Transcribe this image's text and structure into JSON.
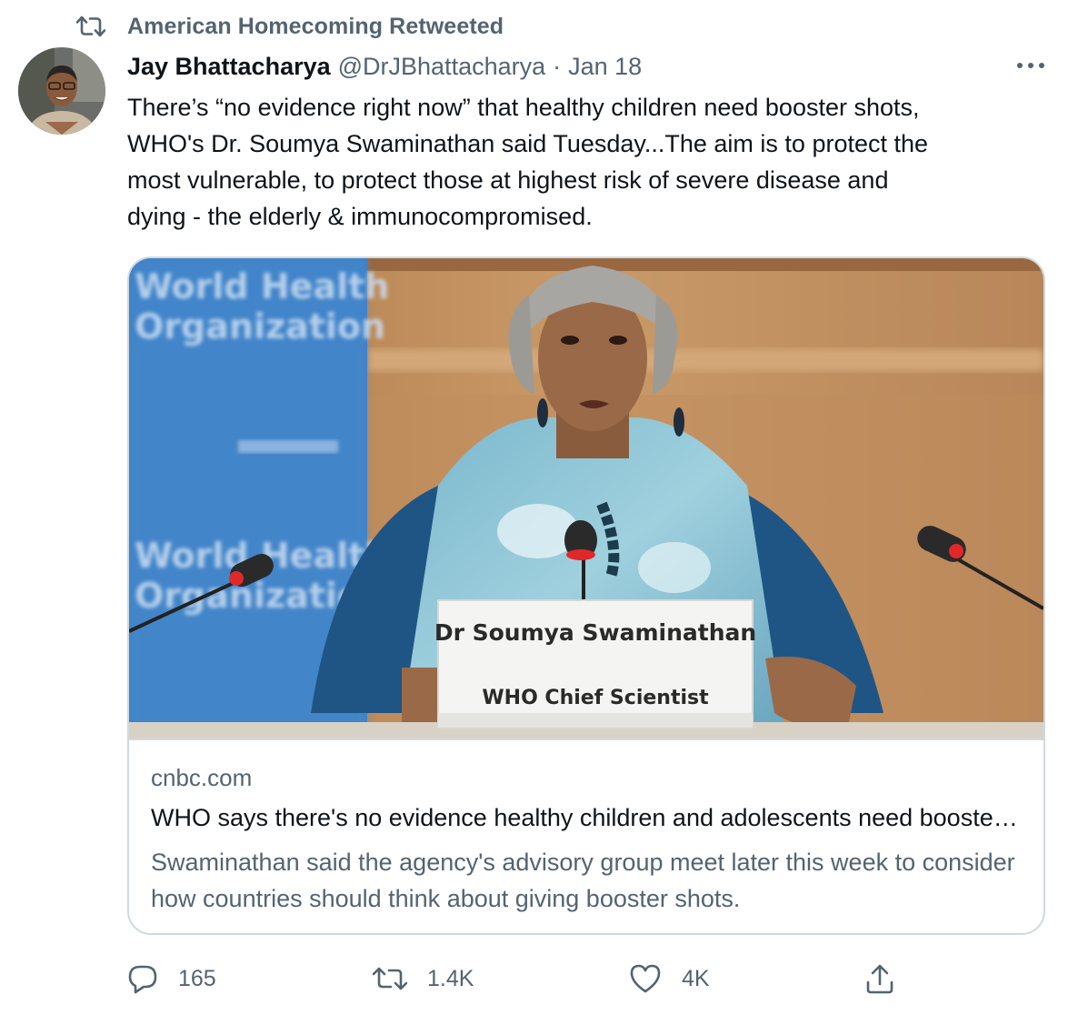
{
  "retweet_context": {
    "text": "American Homecoming Retweeted",
    "icon": "retweet-icon"
  },
  "tweet": {
    "author_name": "Jay Bhattacharya",
    "author_handle": "@DrJBhattacharya",
    "separator": "·",
    "date": "Jan 18",
    "more_icon": "more-icon",
    "text": "There’s “no evidence right now” that healthy children need booster shots,\nWHO's Dr. Soumya Swaminathan said Tuesday...The aim is to protect the\nmost vulnerable, to protect those at highest risk of severe disease and\ndying - the elderly & immunocompromised."
  },
  "link_card": {
    "image": {
      "backdrop_text_line1": "World Health",
      "backdrop_text_line2": "Organization",
      "nameplate_name": "Dr Soumya Swaminathan",
      "nameplate_title": "WHO Chief Scientist"
    },
    "domain": "cnbc.com",
    "title": "WHO says there's no evidence healthy children and adolescents need booster shots",
    "description": "Swaminathan said the agency's advisory group meet later this week to consider how countries should think about giving booster shots."
  },
  "actions": {
    "reply": {
      "icon": "reply-icon",
      "count": "165"
    },
    "retweet": {
      "icon": "retweet-icon",
      "count": "1.4K"
    },
    "like": {
      "icon": "heart-icon",
      "count": "4K"
    },
    "share": {
      "icon": "share-icon"
    }
  },
  "colors": {
    "text_primary": "#0f1419",
    "text_secondary": "#536471",
    "border": "#cfd9de"
  }
}
